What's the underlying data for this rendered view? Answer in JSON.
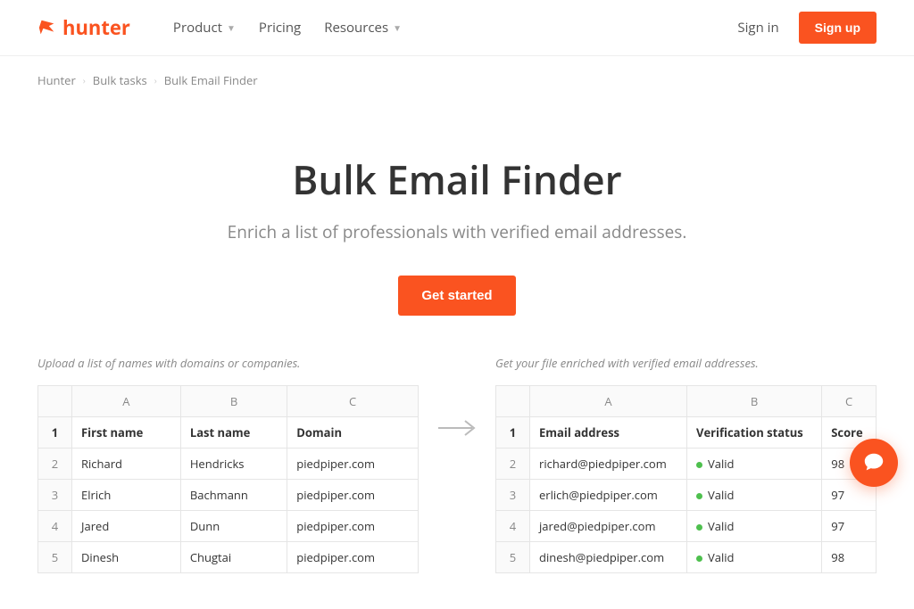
{
  "brand": "hunter",
  "nav": {
    "product": "Product",
    "pricing": "Pricing",
    "resources": "Resources",
    "signin": "Sign in",
    "signup": "Sign up"
  },
  "breadcrumb": {
    "a": "Hunter",
    "b": "Bulk tasks",
    "c": "Bulk Email Finder"
  },
  "hero": {
    "title": "Bulk Email Finder",
    "subtitle": "Enrich a list of professionals with verified email addresses.",
    "cta": "Get started"
  },
  "left": {
    "caption": "Upload a list of names with domains or companies.",
    "cols": {
      "a": "A",
      "b": "B",
      "c": "C"
    },
    "hd": {
      "first": "First name",
      "last": "Last name",
      "domain": "Domain"
    },
    "r2": {
      "n": "2",
      "first": "Richard",
      "last": "Hendricks",
      "domain": "piedpiper.com"
    },
    "r3": {
      "n": "3",
      "first": "Elrich",
      "last": "Bachmann",
      "domain": "piedpiper.com"
    },
    "r4": {
      "n": "4",
      "first": "Jared",
      "last": "Dunn",
      "domain": "piedpiper.com"
    },
    "r5": {
      "n": "5",
      "first": "Dinesh",
      "last": "Chugtai",
      "domain": "piedpiper.com"
    }
  },
  "right": {
    "caption": "Get your file enriched with verified email addresses.",
    "cols": {
      "a": "A",
      "b": "B",
      "c": "C"
    },
    "hd": {
      "email": "Email address",
      "verif": "Verification status",
      "score": "Score"
    },
    "r2": {
      "n": "2",
      "email": "richard@piedpiper.com",
      "status": "Valid",
      "score": "98"
    },
    "r3": {
      "n": "3",
      "email": "erlich@piedpiper.com",
      "status": "Valid",
      "score": "97"
    },
    "r4": {
      "n": "4",
      "email": "jared@piedpiper.com",
      "status": "Valid",
      "score": "97"
    },
    "r5": {
      "n": "5",
      "email": "dinesh@piedpiper.com",
      "status": "Valid",
      "score": "98"
    }
  },
  "row1label": "1"
}
